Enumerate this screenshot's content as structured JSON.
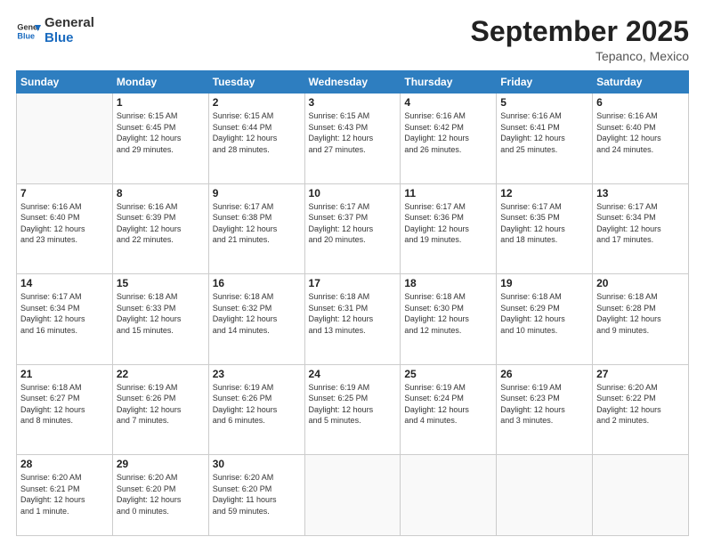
{
  "header": {
    "logo_line1": "General",
    "logo_line2": "Blue",
    "month_title": "September 2025",
    "location": "Tepanco, Mexico"
  },
  "weekdays": [
    "Sunday",
    "Monday",
    "Tuesday",
    "Wednesday",
    "Thursday",
    "Friday",
    "Saturday"
  ],
  "weeks": [
    [
      {
        "day": "",
        "info": ""
      },
      {
        "day": "1",
        "info": "Sunrise: 6:15 AM\nSunset: 6:45 PM\nDaylight: 12 hours\nand 29 minutes."
      },
      {
        "day": "2",
        "info": "Sunrise: 6:15 AM\nSunset: 6:44 PM\nDaylight: 12 hours\nand 28 minutes."
      },
      {
        "day": "3",
        "info": "Sunrise: 6:15 AM\nSunset: 6:43 PM\nDaylight: 12 hours\nand 27 minutes."
      },
      {
        "day": "4",
        "info": "Sunrise: 6:16 AM\nSunset: 6:42 PM\nDaylight: 12 hours\nand 26 minutes."
      },
      {
        "day": "5",
        "info": "Sunrise: 6:16 AM\nSunset: 6:41 PM\nDaylight: 12 hours\nand 25 minutes."
      },
      {
        "day": "6",
        "info": "Sunrise: 6:16 AM\nSunset: 6:40 PM\nDaylight: 12 hours\nand 24 minutes."
      }
    ],
    [
      {
        "day": "7",
        "info": "Sunrise: 6:16 AM\nSunset: 6:40 PM\nDaylight: 12 hours\nand 23 minutes."
      },
      {
        "day": "8",
        "info": "Sunrise: 6:16 AM\nSunset: 6:39 PM\nDaylight: 12 hours\nand 22 minutes."
      },
      {
        "day": "9",
        "info": "Sunrise: 6:17 AM\nSunset: 6:38 PM\nDaylight: 12 hours\nand 21 minutes."
      },
      {
        "day": "10",
        "info": "Sunrise: 6:17 AM\nSunset: 6:37 PM\nDaylight: 12 hours\nand 20 minutes."
      },
      {
        "day": "11",
        "info": "Sunrise: 6:17 AM\nSunset: 6:36 PM\nDaylight: 12 hours\nand 19 minutes."
      },
      {
        "day": "12",
        "info": "Sunrise: 6:17 AM\nSunset: 6:35 PM\nDaylight: 12 hours\nand 18 minutes."
      },
      {
        "day": "13",
        "info": "Sunrise: 6:17 AM\nSunset: 6:34 PM\nDaylight: 12 hours\nand 17 minutes."
      }
    ],
    [
      {
        "day": "14",
        "info": "Sunrise: 6:17 AM\nSunset: 6:34 PM\nDaylight: 12 hours\nand 16 minutes."
      },
      {
        "day": "15",
        "info": "Sunrise: 6:18 AM\nSunset: 6:33 PM\nDaylight: 12 hours\nand 15 minutes."
      },
      {
        "day": "16",
        "info": "Sunrise: 6:18 AM\nSunset: 6:32 PM\nDaylight: 12 hours\nand 14 minutes."
      },
      {
        "day": "17",
        "info": "Sunrise: 6:18 AM\nSunset: 6:31 PM\nDaylight: 12 hours\nand 13 minutes."
      },
      {
        "day": "18",
        "info": "Sunrise: 6:18 AM\nSunset: 6:30 PM\nDaylight: 12 hours\nand 12 minutes."
      },
      {
        "day": "19",
        "info": "Sunrise: 6:18 AM\nSunset: 6:29 PM\nDaylight: 12 hours\nand 10 minutes."
      },
      {
        "day": "20",
        "info": "Sunrise: 6:18 AM\nSunset: 6:28 PM\nDaylight: 12 hours\nand 9 minutes."
      }
    ],
    [
      {
        "day": "21",
        "info": "Sunrise: 6:18 AM\nSunset: 6:27 PM\nDaylight: 12 hours\nand 8 minutes."
      },
      {
        "day": "22",
        "info": "Sunrise: 6:19 AM\nSunset: 6:26 PM\nDaylight: 12 hours\nand 7 minutes."
      },
      {
        "day": "23",
        "info": "Sunrise: 6:19 AM\nSunset: 6:26 PM\nDaylight: 12 hours\nand 6 minutes."
      },
      {
        "day": "24",
        "info": "Sunrise: 6:19 AM\nSunset: 6:25 PM\nDaylight: 12 hours\nand 5 minutes."
      },
      {
        "day": "25",
        "info": "Sunrise: 6:19 AM\nSunset: 6:24 PM\nDaylight: 12 hours\nand 4 minutes."
      },
      {
        "day": "26",
        "info": "Sunrise: 6:19 AM\nSunset: 6:23 PM\nDaylight: 12 hours\nand 3 minutes."
      },
      {
        "day": "27",
        "info": "Sunrise: 6:20 AM\nSunset: 6:22 PM\nDaylight: 12 hours\nand 2 minutes."
      }
    ],
    [
      {
        "day": "28",
        "info": "Sunrise: 6:20 AM\nSunset: 6:21 PM\nDaylight: 12 hours\nand 1 minute."
      },
      {
        "day": "29",
        "info": "Sunrise: 6:20 AM\nSunset: 6:20 PM\nDaylight: 12 hours\nand 0 minutes."
      },
      {
        "day": "30",
        "info": "Sunrise: 6:20 AM\nSunset: 6:20 PM\nDaylight: 11 hours\nand 59 minutes."
      },
      {
        "day": "",
        "info": ""
      },
      {
        "day": "",
        "info": ""
      },
      {
        "day": "",
        "info": ""
      },
      {
        "day": "",
        "info": ""
      }
    ]
  ]
}
